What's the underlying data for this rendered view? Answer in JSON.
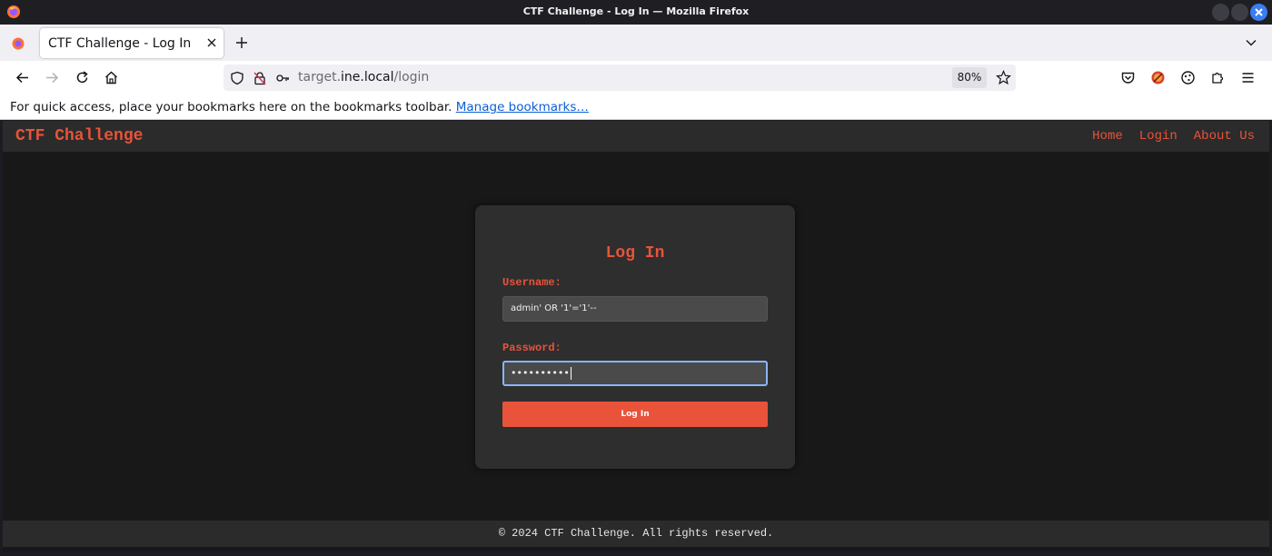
{
  "window": {
    "title": "CTF Challenge - Log In — Mozilla Firefox",
    "controls": [
      "minimize-icon",
      "maximize-icon",
      "close-icon"
    ]
  },
  "browser": {
    "tab": {
      "title": "CTF Challenge - Log In"
    },
    "url": {
      "scheme_prefix": "target.",
      "host": "ine.local",
      "path": "/login"
    },
    "zoom": "80%",
    "bookmarks_bar": {
      "text": "For quick access, place your bookmarks here on the bookmarks toolbar.",
      "link": "Manage bookmarks…"
    }
  },
  "site": {
    "brand": "CTF Challenge",
    "nav": [
      "Home",
      "Login",
      "About Us"
    ],
    "form": {
      "title": "Log In",
      "username_label": "Username:",
      "username_value": "admin' OR '1'='1'--",
      "password_label": "Password:",
      "password_masked": "••••••••••",
      "submit_label": "Log In"
    },
    "footer": "© 2024 CTF Challenge. All rights reserved."
  },
  "colors": {
    "accent": "#e8533a",
    "background": "#181818",
    "card": "#2e2e2e",
    "focus_ring": "#8ab4f8"
  }
}
